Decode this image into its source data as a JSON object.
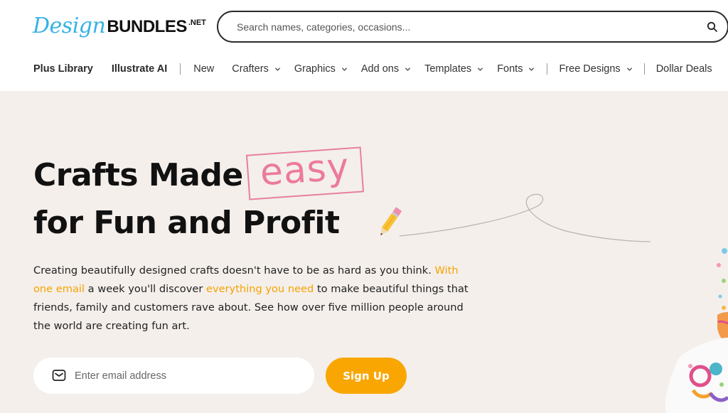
{
  "logo": {
    "design": "Design",
    "bundles": "BUNDLES",
    "net": ".NET"
  },
  "search": {
    "placeholder": "Search names, categories, occasions...",
    "icon": "search-icon"
  },
  "nav": {
    "items": [
      {
        "label": "Plus Library",
        "bold": true,
        "dropdown": false
      },
      {
        "label": "Illustrate AI",
        "bold": true,
        "dropdown": false
      },
      {
        "label": "New",
        "dropdown": false
      },
      {
        "label": "Crafters",
        "dropdown": true
      },
      {
        "label": "Graphics",
        "dropdown": true
      },
      {
        "label": "Add ons",
        "dropdown": true
      },
      {
        "label": "Templates",
        "dropdown": true
      },
      {
        "label": "Fonts",
        "dropdown": true
      },
      {
        "label": "Free Designs",
        "dropdown": true
      },
      {
        "label": "Dollar Deals",
        "dropdown": false
      }
    ]
  },
  "hero": {
    "title_line1": "Crafts Made",
    "title_highlight": "easy",
    "title_line2": "for Fun and Profit",
    "desc_1": "Creating beautifully designed crafts doesn't have to be as hard as you think. ",
    "desc_hl1": "With one email",
    "desc_2": " a week you'll discover ",
    "desc_hl2": "everything you need",
    "desc_3": " to make beautiful things that friends, family and customers rave about. See how over five million people around the world are creating fun art.",
    "email_placeholder": "Enter email address",
    "signup_label": "Sign Up"
  },
  "colors": {
    "brand_blue": "#35b3e6",
    "accent_orange": "#f9a602",
    "highlight_pink": "#ec7a9c",
    "hero_bg": "#f4efeb"
  }
}
